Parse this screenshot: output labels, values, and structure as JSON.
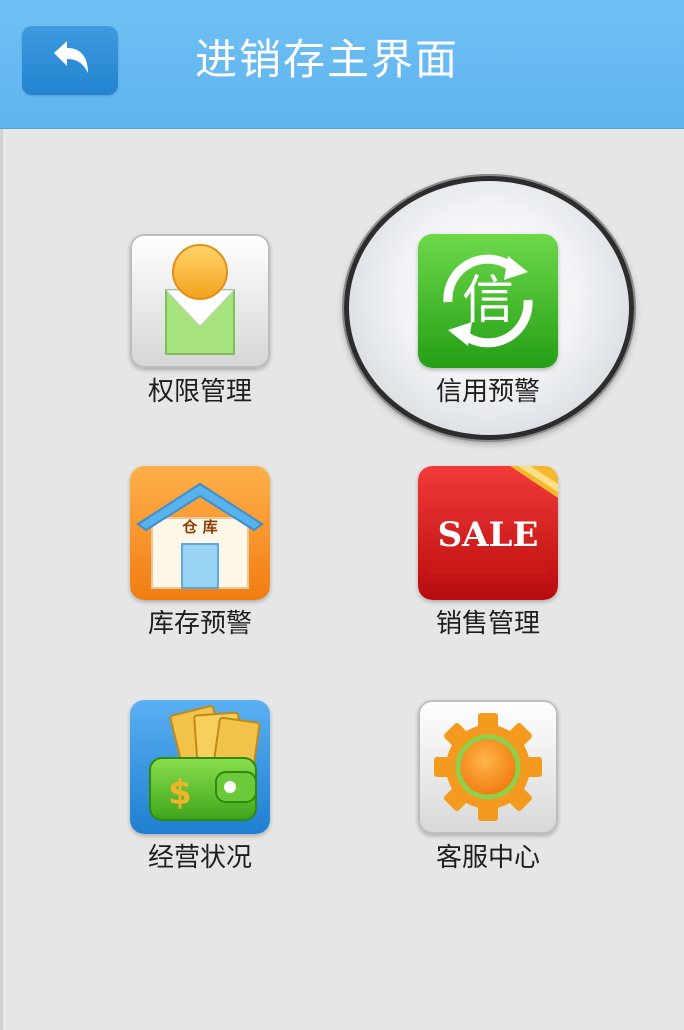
{
  "header": {
    "title": "进销存主界面",
    "back_icon": "back-arrow-icon",
    "bg_color": "#62b6f0"
  },
  "menu": {
    "items": [
      {
        "label": "权限管理",
        "icon": "user-permission-icon"
      },
      {
        "label": "信用预警",
        "icon": "credit-warning-icon",
        "icon_text": "信",
        "selected": true
      },
      {
        "label": "库存预警",
        "icon": "warehouse-icon",
        "icon_text": "仓 库"
      },
      {
        "label": "销售管理",
        "icon": "sale-icon",
        "icon_text": "SALE"
      },
      {
        "label": "经营状况",
        "icon": "wallet-icon",
        "icon_text": "$"
      },
      {
        "label": "客服中心",
        "icon": "gear-icon"
      }
    ]
  }
}
